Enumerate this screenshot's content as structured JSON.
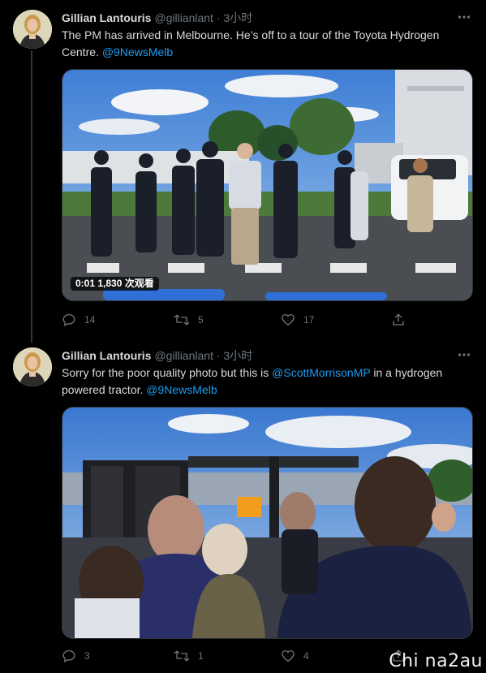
{
  "tweets": [
    {
      "author_name": "Gillian Lantouris",
      "handle": "@gillianlant",
      "separator": "·",
      "time": "3小时",
      "text_before": "The PM has arrived in Melbourne. He’s off to a tour of the Toyota Hydrogen Centre. ",
      "mention_1": "@9NewsMelb",
      "video_time": "0:01",
      "video_views": "1,830 次观看",
      "replies": "14",
      "retweets": "5",
      "likes": "17"
    },
    {
      "author_name": "Gillian Lantouris",
      "handle": "@gillianlant",
      "separator": "·",
      "time": "3小时",
      "text_before": "Sorry for the poor quality photo but this is ",
      "mention_1": "@ScottMorrisonMP",
      "text_middle": " in a hydrogen powered tractor. ",
      "mention_2": "@9NewsMelb",
      "replies": "3",
      "retweets": "1",
      "likes": "4"
    }
  ],
  "icons": {
    "more": "more-horizontal-icon",
    "reply": "reply-icon",
    "retweet": "retweet-icon",
    "like": "heart-icon",
    "share": "share-icon"
  },
  "watermark": "Chi na2au",
  "colors": {
    "background": "#000000",
    "text": "#d9d9d9",
    "muted": "#6e767d",
    "link": "#1d9bf0",
    "thread_line": "#333639"
  }
}
